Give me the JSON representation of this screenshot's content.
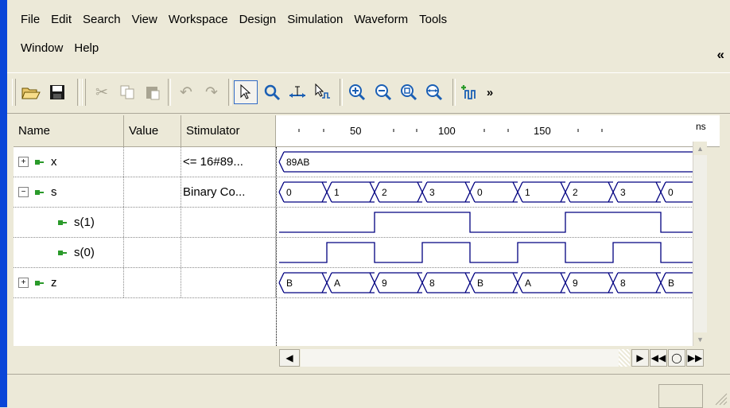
{
  "menu": {
    "row1": [
      "File",
      "Edit",
      "Search",
      "View",
      "Workspace",
      "Design",
      "Simulation",
      "Waveform",
      "Tools"
    ],
    "row2": [
      "Window",
      "Help"
    ],
    "collapse_glyph": "«"
  },
  "toolbar": {
    "icons": [
      "open-folder-icon",
      "save-icon",
      "cut-icon",
      "copy-icon",
      "paste-icon",
      "undo-icon",
      "redo-icon",
      "select-pointer-icon",
      "zoom-mode-icon",
      "measure-icon",
      "edit-signal-icon",
      "zoom-in-icon",
      "zoom-out-icon",
      "zoom-fit-icon",
      "zoom-range-icon",
      "add-signal-icon"
    ],
    "overflow": "»"
  },
  "columns": {
    "name": "Name",
    "value": "Value",
    "stimulator": "Stimulator",
    "unit": "ns"
  },
  "ruler": {
    "ticks": [
      "50",
      "100",
      "150"
    ]
  },
  "signals": [
    {
      "name": "x",
      "value": "",
      "stimulator": "<= 16#89...",
      "expander": "+",
      "wave_type": "bus",
      "values": [
        "89AB"
      ]
    },
    {
      "name": "s",
      "value": "",
      "stimulator": "Binary Co...",
      "expander": "−",
      "wave_type": "bus",
      "values": [
        "0",
        "1",
        "2",
        "3",
        "0",
        "1",
        "2",
        "3",
        "0"
      ]
    },
    {
      "name": "s(1)",
      "value": "",
      "stimulator": "",
      "expander": "",
      "wave_type": "bit",
      "levels": [
        0,
        0,
        1,
        1,
        0,
        0,
        1,
        1,
        0
      ]
    },
    {
      "name": "s(0)",
      "value": "",
      "stimulator": "",
      "expander": "",
      "wave_type": "bit",
      "levels": [
        0,
        1,
        0,
        1,
        0,
        1,
        0,
        1,
        0
      ]
    },
    {
      "name": "z",
      "value": "",
      "stimulator": "",
      "expander": "+",
      "wave_type": "bus",
      "values": [
        "B",
        "A",
        "9",
        "8",
        "B",
        "A",
        "9",
        "8",
        "B"
      ]
    }
  ],
  "colors": {
    "waveform": "#000080",
    "title_blue": "#0A46D8",
    "signal_icon": "#2A9A2A"
  }
}
